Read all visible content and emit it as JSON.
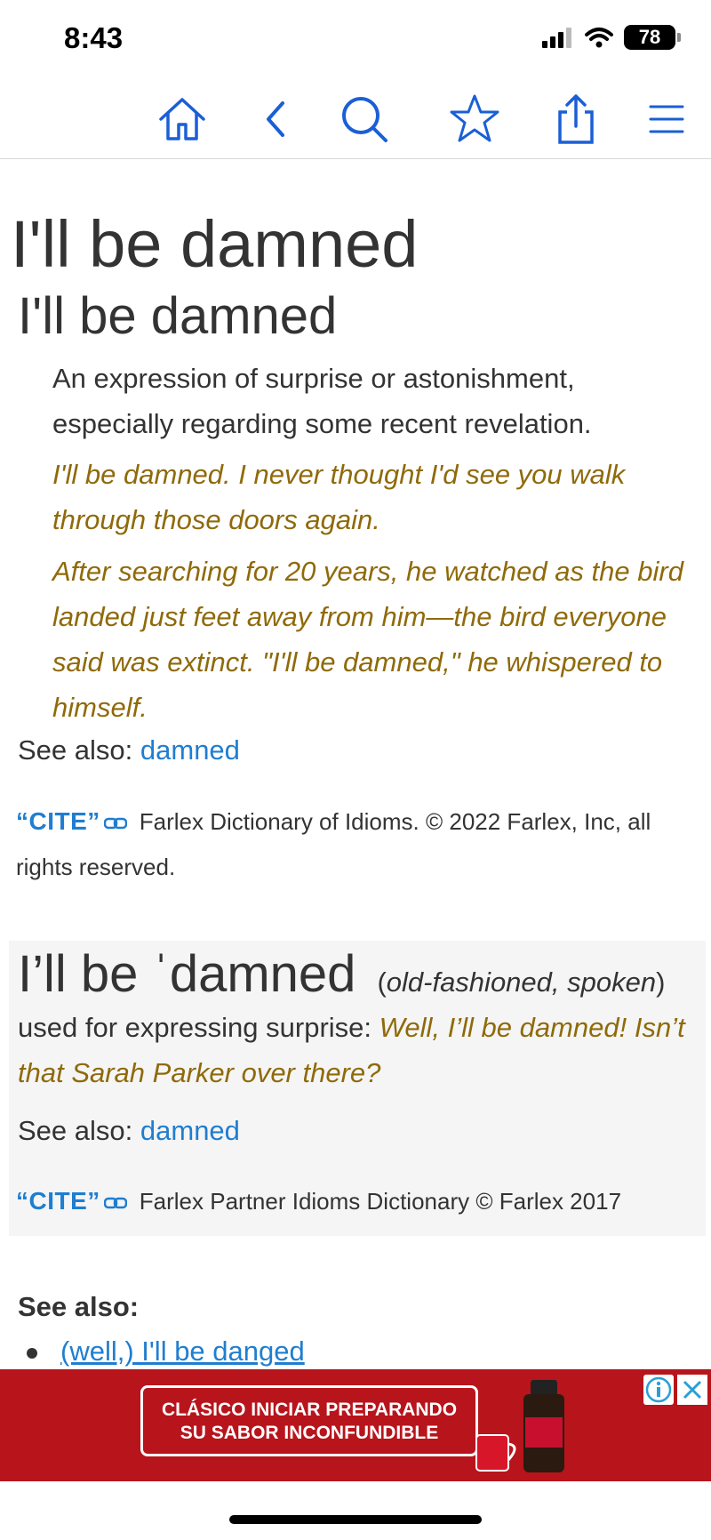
{
  "status": {
    "time": "8:43",
    "battery": "78"
  },
  "toolbar": {
    "icons": [
      "home-icon",
      "back-icon",
      "search-icon",
      "star-icon",
      "share-icon",
      "menu-icon"
    ],
    "accent": "#1a5fd6"
  },
  "entry1": {
    "title": "I'll be damned",
    "headword": "I'll be damned",
    "definition": "An expression of surprise or astonishment, especially regarding some recent revelation.",
    "examples": [
      "I'll be damned. I never thought I'd see you walk through those doors again.",
      "After searching for 20 years, he watched as the bird landed just feet away from him—the bird everyone said was extinct. \"I'll be damned,\" he whispered to himself."
    ],
    "see_also_label": "See also:",
    "see_also_link": "damned",
    "cite_logo": "“CITE”",
    "cite_text": "Farlex Dictionary of Idioms. © 2022 Farlex, Inc, all rights reserved."
  },
  "entry2": {
    "headword": "I’ll be ˈdamned",
    "usage": "old-fashioned, spoken",
    "definition": "used for expressing surprise:",
    "example": "Well, I’ll be damned! Isn’t that Sarah Parker over there?",
    "see_also_label": "See also:",
    "see_also_link": "damned",
    "cite_logo": "“CITE”",
    "cite_text": "Farlex Partner Idioms Dictionary © Farlex 2017"
  },
  "see_also_section": {
    "heading": "See also:",
    "items": [
      "(well,) I'll be danged"
    ]
  },
  "ad": {
    "line1": "CLÁSICO INICIAR PREPARANDO",
    "line2": "SU SABOR INCONFUNDIBLE",
    "background": "#b8141c"
  },
  "colors": {
    "link": "#1f7ed0",
    "example": "#8f6a0a",
    "text": "#333333"
  }
}
